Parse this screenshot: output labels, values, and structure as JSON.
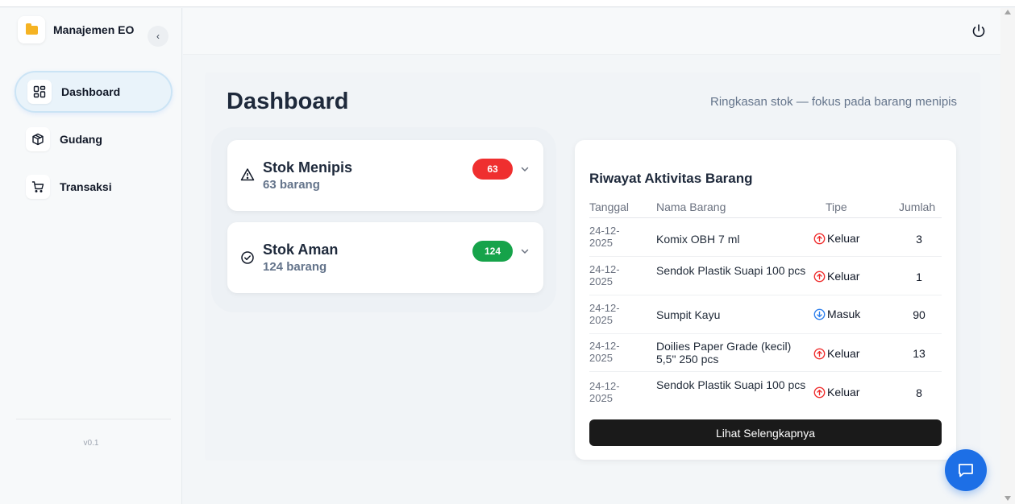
{
  "app": {
    "title": "Manajemen EO",
    "version": "v0.1"
  },
  "sidebar": {
    "collapse_icon": "chevron-left-icon",
    "items": [
      {
        "label": "Dashboard",
        "icon": "dashboard-grid-icon",
        "active": true
      },
      {
        "label": "Gudang",
        "icon": "box-icon",
        "active": false
      },
      {
        "label": "Transaksi",
        "icon": "cart-icon",
        "active": false
      }
    ]
  },
  "header": {
    "power_icon": "power-icon"
  },
  "page": {
    "title": "Dashboard",
    "subtitle": "Ringkasan stok — fokus pada barang menipis"
  },
  "stock": {
    "low": {
      "title": "Stok Menipis",
      "subtitle": "63 barang",
      "badge": "63",
      "badge_color": "#ef2f2f",
      "icon": "warning-triangle-icon"
    },
    "safe": {
      "title": "Stok Aman",
      "subtitle": "124 barang",
      "badge": "124",
      "badge_color": "#16a34a",
      "icon": "check-circle-icon"
    }
  },
  "activity": {
    "title": "Riwayat Aktivitas Barang",
    "headers": {
      "date": "Tanggal",
      "name": "Nama Barang",
      "type": "Tipe",
      "qty": "Jumlah"
    },
    "rows": [
      {
        "date": "24-12-2025",
        "name": "Komix OBH 7 ml",
        "type": "Keluar",
        "qty": "3"
      },
      {
        "date": "24-12-2025",
        "name": "Sendok Plastik Suapi 100 pcs",
        "type": "Keluar",
        "qty": "1"
      },
      {
        "date": "24-12-2025",
        "name": "Sumpit Kayu",
        "type": "Masuk",
        "qty": "90"
      },
      {
        "date": "24-12-2025",
        "name": "Doilies Paper Grade (kecil) 5,5\" 250 pcs",
        "type": "Keluar",
        "qty": "13"
      },
      {
        "date": "24-12-2025",
        "name": "Sendok Plastik Suapi 100 pcs",
        "type": "Keluar",
        "qty": "8"
      }
    ],
    "more_label": "Lihat Selengkapnya",
    "colors": {
      "out": "#ef2f2f",
      "in": "#2f80ed"
    }
  },
  "fab": {
    "icon": "chat-icon"
  }
}
